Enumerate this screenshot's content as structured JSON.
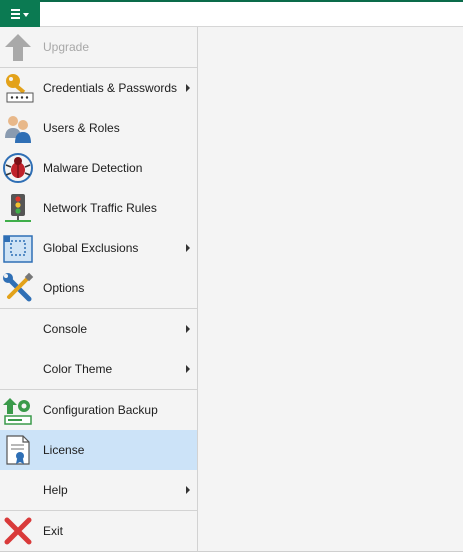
{
  "topbar": {
    "menu_icon": "hamburger-menu-icon"
  },
  "menu": {
    "items": [
      {
        "label": "Upgrade",
        "icon": "upgrade-arrow-icon",
        "disabled": true
      },
      {
        "label": "Credentials & Passwords",
        "icon": "key-icon",
        "submenu": true
      },
      {
        "label": "Users & Roles",
        "icon": "users-icon"
      },
      {
        "label": "Malware Detection",
        "icon": "bug-icon"
      },
      {
        "label": "Network Traffic Rules",
        "icon": "traffic-light-icon"
      },
      {
        "label": "Global Exclusions",
        "icon": "exclusion-icon",
        "submenu": true
      },
      {
        "label": "Options",
        "icon": "wrench-screwdriver-icon"
      },
      {
        "label": "Console",
        "submenu": true
      },
      {
        "label": "Color Theme",
        "submenu": true
      },
      {
        "label": "Configuration Backup",
        "icon": "config-backup-icon"
      },
      {
        "label": "License",
        "icon": "license-document-icon",
        "selected": true
      },
      {
        "label": "Help",
        "submenu": true
      },
      {
        "label": "Exit",
        "icon": "exit-x-icon"
      }
    ]
  },
  "colors": {
    "accent_green": "#0b7a52",
    "selected_bg": "#cce3f8",
    "panel_bg": "#f4f4f4"
  }
}
